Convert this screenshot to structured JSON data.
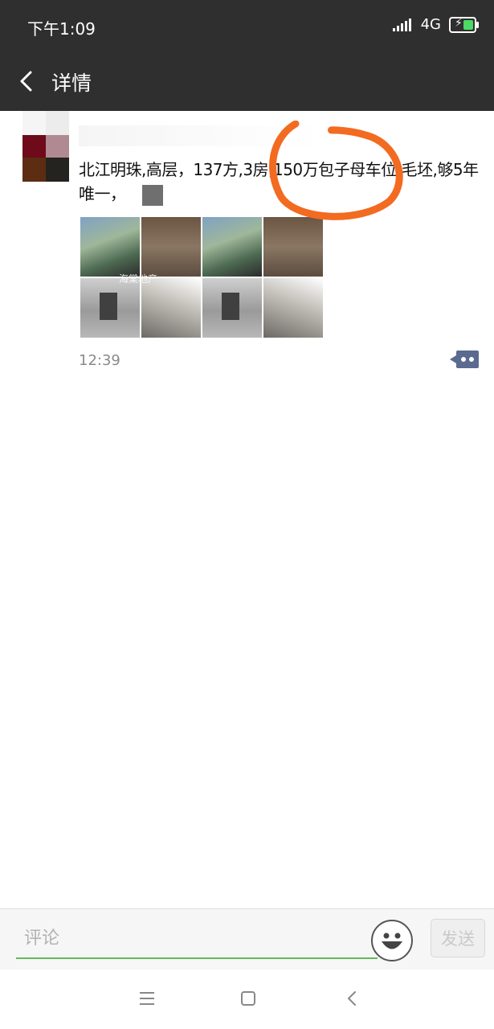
{
  "status_bar": {
    "time": "下午1:09",
    "network": "4G"
  },
  "nav": {
    "title": "详情"
  },
  "post": {
    "text": "北江明珠,高层，137方,3房,150万包子母车位,毛坯,够5年唯一，",
    "watermark": "海棠地产",
    "time": "12:39",
    "photo_count": 8
  },
  "comment_bar": {
    "input_placeholder": "评论",
    "send_label": "发送"
  },
  "colors": {
    "bar_bg": "#2f2f2f",
    "link_blue": "#5b6a91",
    "input_green": "#62b85a",
    "annotation_orange": "#f26b21",
    "battery_green": "#4cd964"
  },
  "icons": [
    "back-icon",
    "signal-icon",
    "battery-icon",
    "comment-action-icon",
    "emoji-icon",
    "menu-icon",
    "home-icon",
    "back-nav-icon"
  ]
}
